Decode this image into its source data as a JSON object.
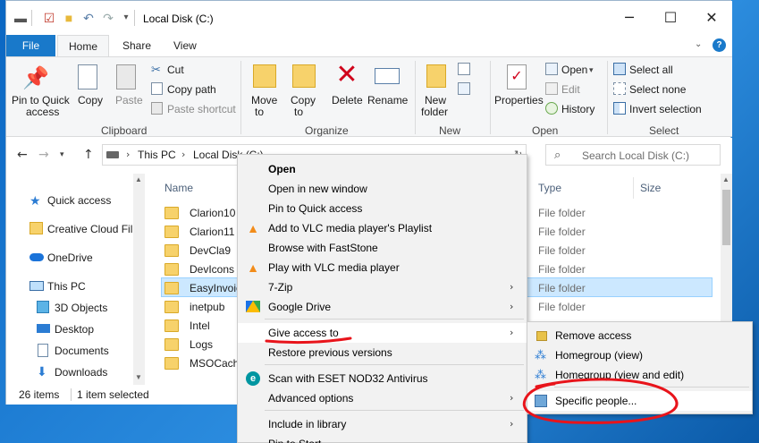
{
  "window": {
    "title": "Local Disk (C:)"
  },
  "tabs": [
    "File",
    "Home",
    "Share",
    "View"
  ],
  "ribbon": {
    "clipboard": {
      "group": "Clipboard",
      "pin": [
        "Pin to Quick",
        "access"
      ],
      "copy": "Copy",
      "paste": "Paste",
      "cut": "Cut",
      "copy_path": "Copy path",
      "paste_shortcut": "Paste shortcut"
    },
    "organize": {
      "group": "Organize",
      "move": [
        "Move",
        "to"
      ],
      "copy": [
        "Copy",
        "to"
      ],
      "delete": "Delete",
      "rename": "Rename"
    },
    "new": {
      "group": "New",
      "new_folder": [
        "New",
        "folder"
      ]
    },
    "open": {
      "group": "Open",
      "properties": "Properties",
      "open": "Open",
      "edit": "Edit",
      "history": "History"
    },
    "select": {
      "group": "Select",
      "select_all": "Select all",
      "select_none": "Select none",
      "invert": "Invert selection"
    }
  },
  "address": {
    "crumbs": [
      "This PC",
      "Local Disk (C:)"
    ]
  },
  "search": {
    "placeholder": "Search Local Disk (C:)"
  },
  "nav": {
    "items": [
      {
        "label": "Quick access",
        "icon": "star-icon"
      },
      {
        "label": "Creative Cloud Fil",
        "icon": "creative-cloud-icon"
      },
      {
        "label": "OneDrive",
        "icon": "cloud-icon"
      },
      {
        "label": "This PC",
        "icon": "computer-icon"
      },
      {
        "label": "3D Objects",
        "icon": "cube-icon"
      },
      {
        "label": "Desktop",
        "icon": "desktop-icon"
      },
      {
        "label": "Documents",
        "icon": "document-icon"
      },
      {
        "label": "Downloads",
        "icon": "download-icon"
      }
    ]
  },
  "columns": {
    "name": "Name",
    "type": "Type",
    "size": "Size"
  },
  "files": [
    {
      "name": "Clarion10",
      "type": "File folder"
    },
    {
      "name": "Clarion11",
      "type": "File folder"
    },
    {
      "name": "DevCla9",
      "type": "File folder"
    },
    {
      "name": "DevIcons",
      "type": "File folder"
    },
    {
      "name": "EasyInvoice",
      "type": "File folder",
      "selected": true
    },
    {
      "name": "inetpub",
      "type": "File folder"
    },
    {
      "name": "Intel",
      "type": ""
    },
    {
      "name": "Logs",
      "type": ""
    },
    {
      "name": "MSOCache",
      "type": ""
    }
  ],
  "status": {
    "count": "26 items",
    "selected": "1 item selected"
  },
  "context_menu": {
    "items": [
      "Open",
      "Open in new window",
      "Pin to Quick access",
      "Add to VLC media player's Playlist",
      "Browse with FastStone",
      "Play with VLC media player",
      "7-Zip",
      "Google Drive",
      "Give access to",
      "Restore previous versions",
      "Scan with ESET NOD32 Antivirus",
      "Advanced options",
      "Include in library",
      "Pin to Start"
    ]
  },
  "submenu": {
    "items": [
      "Remove access",
      "Homegroup (view)",
      "Homegroup (view and edit)",
      "Specific people..."
    ]
  },
  "colors": {
    "accent": "#1979ca",
    "selection": "#cce8ff",
    "annotation": "#e8141b",
    "folder": "#f7d26b"
  }
}
